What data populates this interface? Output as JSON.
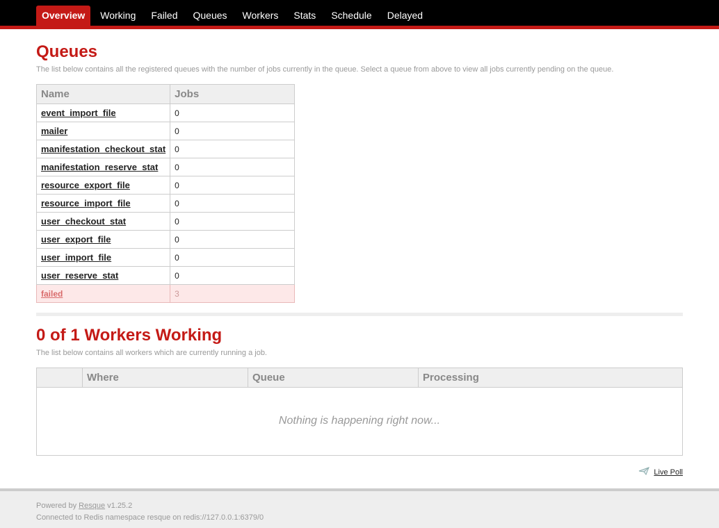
{
  "nav": {
    "tabs": [
      "Overview",
      "Working",
      "Failed",
      "Queues",
      "Workers",
      "Stats",
      "Schedule",
      "Delayed"
    ]
  },
  "queues": {
    "title": "Queues",
    "description": "The list below contains all the registered queues with the number of jobs currently in the queue. Select a queue from above to view all jobs currently pending on the queue.",
    "columns": [
      "Name",
      "Jobs"
    ],
    "rows": [
      {
        "name": "event_import_file",
        "jobs": "0"
      },
      {
        "name": "mailer",
        "jobs": "0"
      },
      {
        "name": "manifestation_checkout_stat",
        "jobs": "0"
      },
      {
        "name": "manifestation_reserve_stat",
        "jobs": "0"
      },
      {
        "name": "resource_export_file",
        "jobs": "0"
      },
      {
        "name": "resource_import_file",
        "jobs": "0"
      },
      {
        "name": "user_checkout_stat",
        "jobs": "0"
      },
      {
        "name": "user_export_file",
        "jobs": "0"
      },
      {
        "name": "user_import_file",
        "jobs": "0"
      },
      {
        "name": "user_reserve_stat",
        "jobs": "0"
      }
    ],
    "failed": {
      "name": "failed",
      "jobs": "3"
    }
  },
  "workers": {
    "title": "0 of 1 Workers Working",
    "description": "The list below contains all workers which are currently running a job.",
    "columns": [
      "",
      "Where",
      "Queue",
      "Processing"
    ],
    "empty": "Nothing is happening right now...",
    "live_poll": "Live Poll"
  },
  "footer": {
    "powered_prefix": "Powered by",
    "powered_link": "Resque",
    "version": "v1.25.2",
    "connection": "Connected to Redis namespace resque on redis://127.0.0.1:6379/0"
  },
  "colors": {
    "accent": "#c41a16",
    "nav": "#000000"
  }
}
